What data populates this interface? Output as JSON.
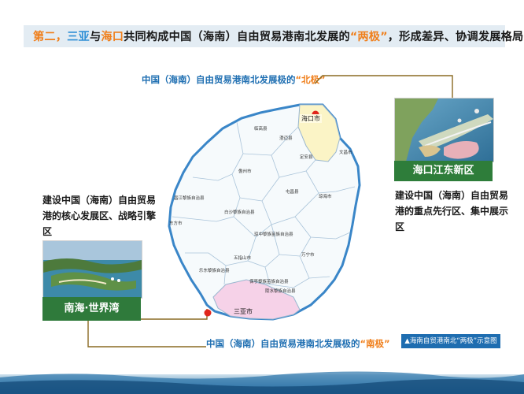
{
  "title": {
    "part1": "第二，",
    "part2": "三亚",
    "part3": "与",
    "part4": "海口",
    "part5": "共同构成中国（海南）自由贸易港南北发展的",
    "part6": "“两极”",
    "part7": "，形成差异、协调发展格局"
  },
  "north_pole_label": {
    "text": "中国（海南）自由贸易港南北发展极的",
    "quote": "“北极”"
  },
  "south_pole_label": {
    "text": "中国（海南）自由贸易港南北发展极的",
    "quote": "“南极”"
  },
  "left_desc": [
    "建设中国（海南）自由贸易",
    "港的核心发展区、战略引擎",
    "区"
  ],
  "right_desc": [
    "建设中国（海南）自由贸易",
    "港的重点先行区、集中展示",
    "区"
  ],
  "left_caption": "南海·世界湾",
  "right_caption": "海口江东新区",
  "legend": "▲海南自贸港南北“两极”示意图",
  "map": {
    "city_haikou": "海口市",
    "city_sanya": "三亚市",
    "counties": [
      "临高县",
      "澄迈县",
      "定安县",
      "文昌市",
      "儋州市",
      "屯昌县",
      "琼海市",
      "昌江黎族自治县",
      "白沙黎族自治县",
      "琼中黎族苗族自治县",
      "东方市",
      "五指山市",
      "万宁市",
      "乐东黎族自治县",
      "保亭黎族苗族自治县",
      "陵水黎族自治县"
    ],
    "colors": {
      "island_fill": "#f6fafc",
      "island_border": "#3a86c8",
      "haikou_fill": "#fbf4c6",
      "sanya_fill": "#f6d2e8",
      "marker": "#e0261c",
      "connector": "#8a6a22"
    }
  }
}
